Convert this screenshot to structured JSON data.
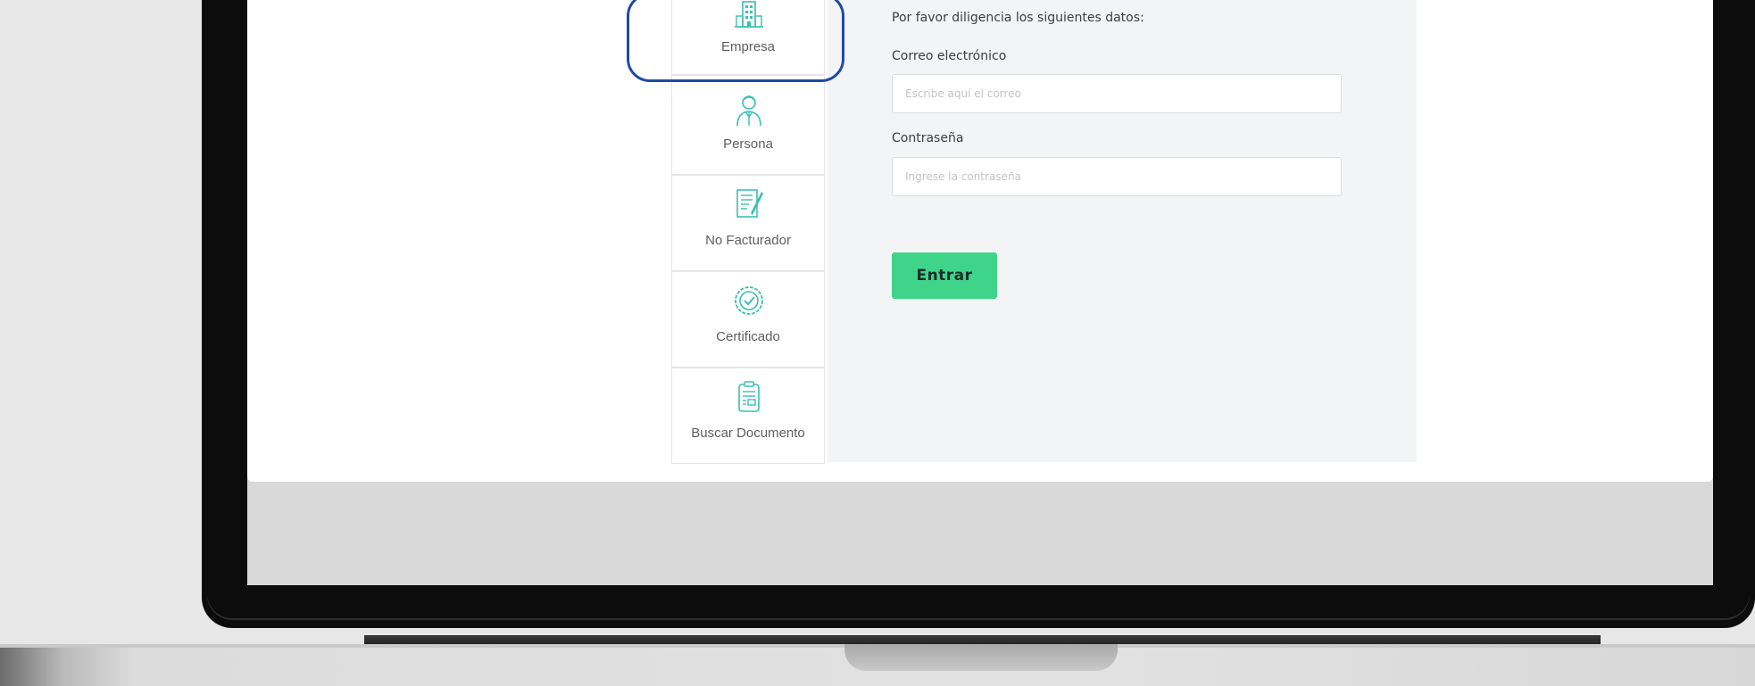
{
  "sidebar": {
    "tabs": [
      {
        "label": "Empresa",
        "icon": "building-icon"
      },
      {
        "label": "Persona",
        "icon": "person-icon"
      },
      {
        "label": "No Facturador",
        "icon": "document-edit-icon"
      },
      {
        "label": "Certificado",
        "icon": "certificate-badge-icon"
      },
      {
        "label": "Buscar Documento",
        "icon": "search-document-icon"
      }
    ],
    "selected_tab": "Empresa"
  },
  "form": {
    "instructions": "Por favor diligencia los siguientes datos:",
    "email_label": "Correo electrónico",
    "email_placeholder": "Escribe aquí el correo",
    "email_value": "",
    "password_label": "Contraseña",
    "password_placeholder": "Ingrese la contraseña",
    "password_value": "",
    "submit_label": "Entrar"
  },
  "colors": {
    "accent_green": "#3ed58b",
    "icon_teal": "#3bbfb3",
    "highlight_blue": "#1f4aa8",
    "panel_bg": "#f2f4f6"
  }
}
